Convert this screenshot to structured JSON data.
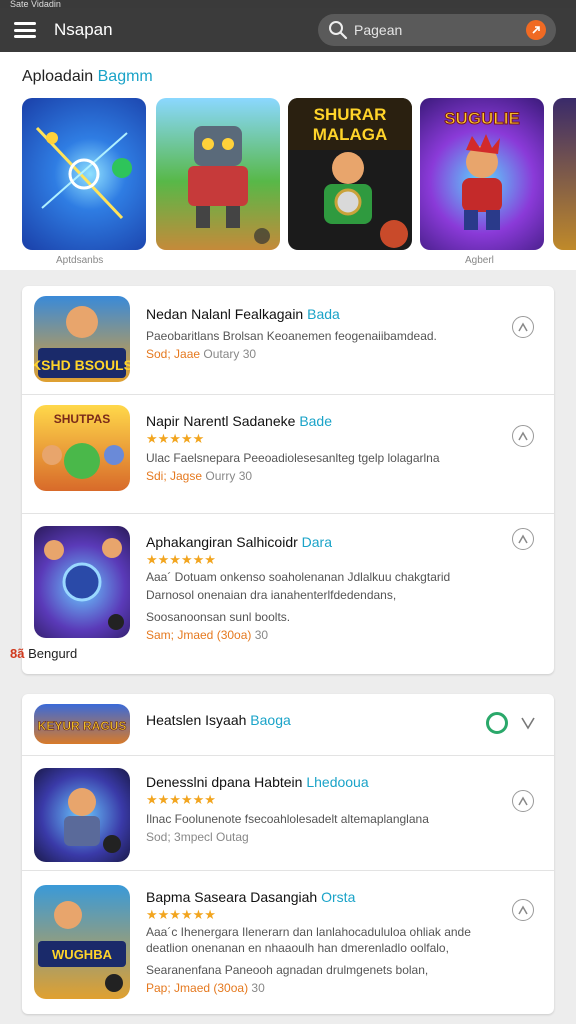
{
  "statusbar": {
    "left": "Sate Vidadin "
  },
  "appbar": {
    "title": "Nsapan",
    "search_placeholder": "Pagean"
  },
  "featured": {
    "title_main": "Aploadain",
    "title_accent": "Bagmm",
    "tiles": [
      {
        "caption": "Aptdsanbs",
        "text": ""
      },
      {
        "caption": "",
        "text": ""
      },
      {
        "caption": "",
        "text": "SHURAR MALAGA"
      },
      {
        "caption": "Agberl",
        "text": "SUGULIE"
      },
      {
        "caption": "",
        "text": ""
      }
    ]
  },
  "list1": [
    {
      "title": "Nedan Nalanl Fealkagain",
      "tag": "Bada",
      "stars": "",
      "desc": "Paeobaritlans Brolsan Keoanemen feogenaiibamdead.",
      "desc2": "",
      "desc3": "",
      "meta_hl": "Sod; Jaae",
      "meta": "Outary  30",
      "thumb_text": "KSHD BSOULS"
    },
    {
      "title": "Napir Narentl Sadaneke",
      "tag": "Bade",
      "stars": "★★★★★",
      "desc": "Ulac Faelsnepara Peeoadiolesesanlteg tgelp lolagarlna",
      "desc2": "",
      "desc3": "",
      "meta_hl": "Sdi; Jagse",
      "meta": "Ourry  30",
      "thumb_text": "SHUTPAS"
    },
    {
      "title": "Aphakangiran Salhicoidr",
      "tag": "Dara",
      "stars": "★★★★★★",
      "desc": "Aaa´ Dotuam onkenso soaholenanan Jdlalkuu chakgtarid",
      "desc2": "Darnosol onenaian dra ianahenterlfdedendans,",
      "desc3": "Soosanoonsan sunl boolts.",
      "meta_hl": "Sam; Jmaed (30oa)",
      "meta": "30",
      "thumb_text": ""
    }
  ],
  "promo_label": "Bengurd",
  "promo_prefix": "8ã",
  "list2_header": {
    "title": "Heatslen Isyaah",
    "tag": "Baoga",
    "thumb_text": "KEYUR RAGUS"
  },
  "list2": [
    {
      "title": "Denesslni dpana Habtein",
      "tag": "Lhedooua",
      "stars": "★★★★★★",
      "desc": "Ilnac Foolunenote fsecoahlolesadelt altemaplanglana",
      "desc2": "",
      "desc3": "",
      "meta_hl": "",
      "meta": "Sod; 3mpecl Outag",
      "thumb_text": ""
    },
    {
      "title": "Bapma Saseara Dasangiah",
      "tag": "Orsta",
      "stars": "★★★★★★",
      "desc": "Aaa´c Ihenergara Ilenerarn dan lanlahocadululoa ohliak ande",
      "desc2": "deatlion onenanan en nhaaoulh han dmerenladlo oolfalo,",
      "desc3": "Searanenfana Paneooh agnadan drulmgenets bolan,",
      "meta_hl": "Pap; Jmaed (30oa)",
      "meta": "30",
      "thumb_text": "WUGHBA"
    }
  ],
  "colors": {
    "accent": "#1aa3c8",
    "star": "#f2a51f",
    "appbar": "#3b3b3b",
    "badge": "#f06a23"
  }
}
